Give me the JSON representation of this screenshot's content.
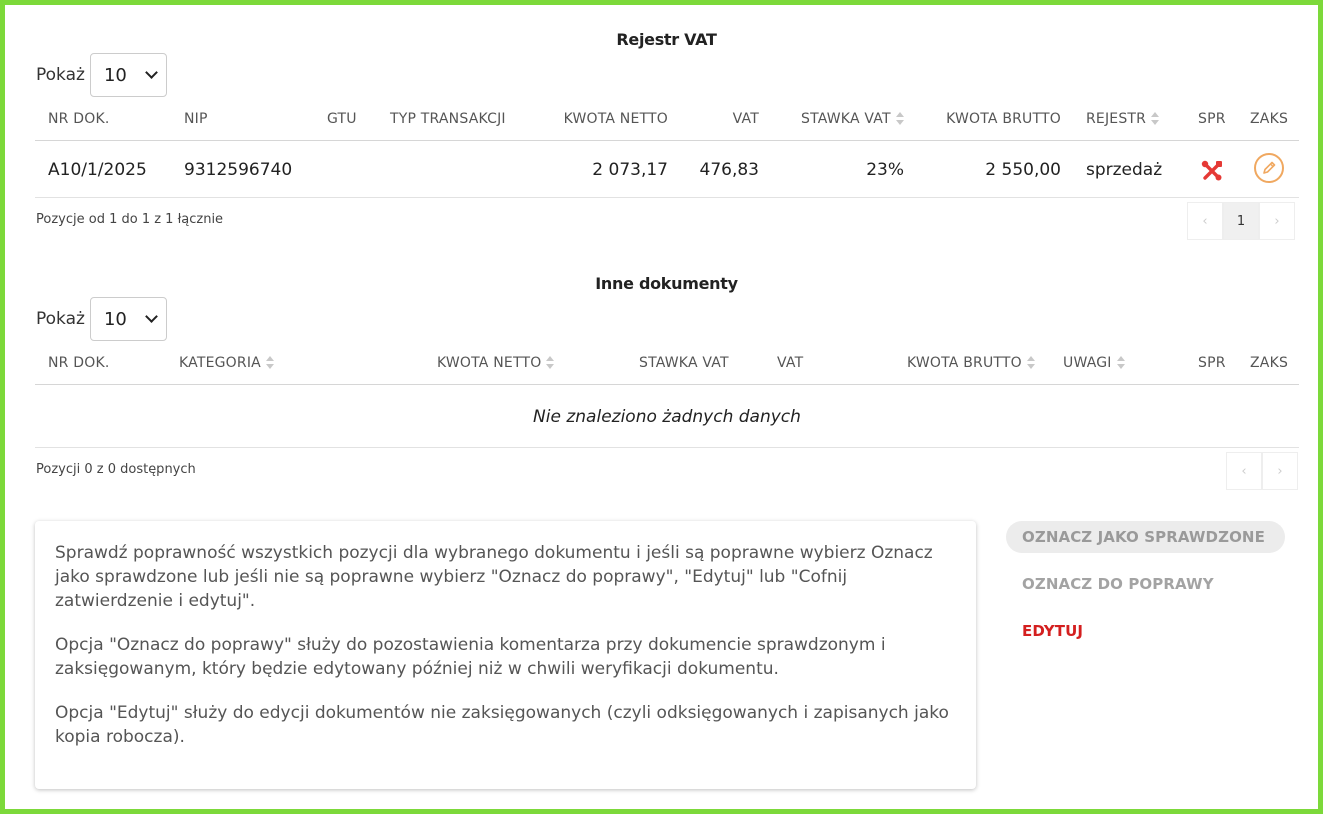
{
  "vat_register": {
    "title": "Rejestr VAT",
    "show_label": "Pokaż",
    "page_size": "10",
    "columns": {
      "doc_no": "NR DOK.",
      "nip": "NIP",
      "gtu": "GTU",
      "transaction_type": "TYP TRANSAKCJI",
      "net_amount": "KWOTA NETTO",
      "vat": "VAT",
      "vat_rate": "STAWKA VAT",
      "gross_amount": "KWOTA BRUTTO",
      "register": "REJESTR",
      "spr": "SPR",
      "zaks": "ZAKS"
    },
    "rows": [
      {
        "doc_no": "A10/1/2025",
        "nip": "9312596740",
        "gtu": "",
        "transaction_type": "",
        "net_amount": "2 073,17",
        "vat": "476,83",
        "vat_rate": "23%",
        "gross_amount": "2 550,00",
        "register": "sprzedaż",
        "spr_icon": "tools-icon",
        "zaks_icon": "pencil-icon"
      }
    ],
    "info": "Pozycje od 1 do 1 z 1 łącznie",
    "pager": {
      "prev": "‹",
      "current": "1",
      "next": "›"
    }
  },
  "other_docs": {
    "title": "Inne dokumenty",
    "show_label": "Pokaż",
    "page_size": "10",
    "columns": {
      "doc_no": "NR DOK.",
      "category": "KATEGORIA",
      "net_amount": "KWOTA NETTO",
      "vat_rate": "STAWKA VAT",
      "vat": "VAT",
      "gross_amount": "KWOTA BRUTTO",
      "notes": "UWAGI",
      "spr": "SPR",
      "zaks": "ZAKS"
    },
    "empty_message": "Nie znaleziono żadnych danych",
    "info": "Pozycji 0 z 0 dostępnych",
    "pager": {
      "prev": "‹",
      "next": "›"
    }
  },
  "notice": {
    "p1": "Sprawdź poprawność wszystkich pozycji dla wybranego dokumentu i jeśli są poprawne wybierz Oznacz jako sprawdzone lub jeśli nie są poprawne wybierz \"Oznacz do poprawy\", \"Edytuj\" lub \"Cofnij zatwierdzenie i edytuj\".",
    "p2": "Opcja \"Oznacz do poprawy\" służy do pozostawienia komentarza przy dokumencie sprawdzonym i zaksięgowanym, który będzie edytowany później niż w chwili weryfikacji dokumentu.",
    "p3": "Opcja \"Edytuj\" służy do edycji dokumentów nie zaksięgowanych (czyli odksięgowanych i zapisanych jako kopia robocza)."
  },
  "actions": {
    "mark_checked": "OZNACZ JAKO SPRAWDZONE",
    "mark_for_fix": "OZNACZ DO POPRAWY",
    "edit": "EDYTUJ"
  },
  "colors": {
    "frame": "#7cd93a",
    "edit_action": "#d41f1f",
    "tools_icon": "#e53935",
    "pencil_icon": "#f0a860"
  }
}
